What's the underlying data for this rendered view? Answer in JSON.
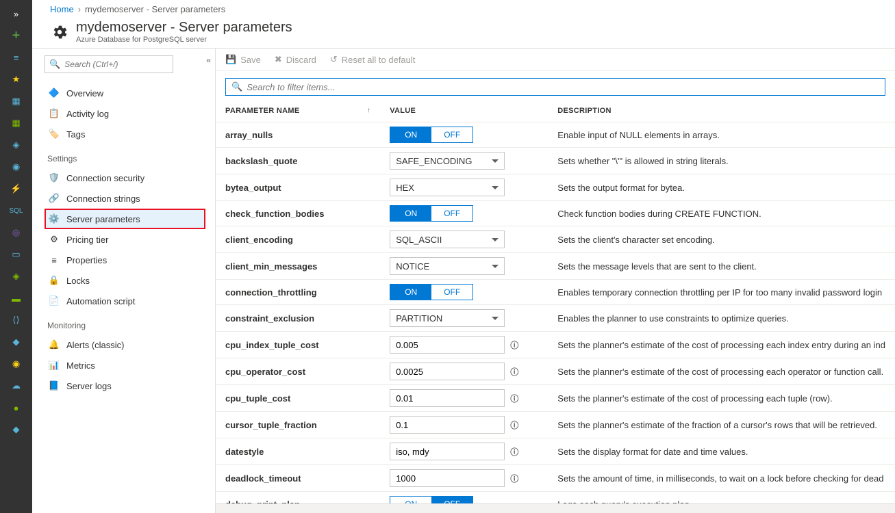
{
  "breadcrumb": {
    "home": "Home",
    "current": "mydemoserver - Server parameters"
  },
  "title": "mydemoserver - Server parameters",
  "subtitle": "Azure Database for PostgreSQL server",
  "sidebar": {
    "search_placeholder": "Search (Ctrl+/)",
    "top": [
      {
        "label": "Overview",
        "icon": "sphere"
      },
      {
        "label": "Activity log",
        "icon": "log"
      },
      {
        "label": "Tags",
        "icon": "tag"
      }
    ],
    "sections": [
      {
        "heading": "Settings",
        "items": [
          {
            "label": "Connection security",
            "icon": "shield"
          },
          {
            "label": "Connection strings",
            "icon": "link"
          },
          {
            "label": "Server parameters",
            "icon": "gear",
            "active": true
          },
          {
            "label": "Pricing tier",
            "icon": "pricing"
          },
          {
            "label": "Properties",
            "icon": "props"
          },
          {
            "label": "Locks",
            "icon": "lock"
          },
          {
            "label": "Automation script",
            "icon": "script"
          }
        ]
      },
      {
        "heading": "Monitoring",
        "items": [
          {
            "label": "Alerts (classic)",
            "icon": "alert"
          },
          {
            "label": "Metrics",
            "icon": "metrics"
          },
          {
            "label": "Server logs",
            "icon": "logs"
          }
        ]
      }
    ]
  },
  "toolbar": {
    "save": "Save",
    "discard": "Discard",
    "reset": "Reset all to default"
  },
  "filter_placeholder": "Search to filter items...",
  "columns": {
    "name": "Parameter Name",
    "value": "Value",
    "desc": "Description"
  },
  "rows": [
    {
      "name": "array_nulls",
      "type": "toggle",
      "value": "ON",
      "desc": "Enable input of NULL elements in arrays."
    },
    {
      "name": "backslash_quote",
      "type": "select",
      "value": "SAFE_ENCODING",
      "desc": "Sets whether \"\\'\" is allowed in string literals."
    },
    {
      "name": "bytea_output",
      "type": "select",
      "value": "HEX",
      "desc": "Sets the output format for bytea."
    },
    {
      "name": "check_function_bodies",
      "type": "toggle",
      "value": "ON",
      "desc": "Check function bodies during CREATE FUNCTION."
    },
    {
      "name": "client_encoding",
      "type": "select",
      "value": "SQL_ASCII",
      "desc": "Sets the client's character set encoding."
    },
    {
      "name": "client_min_messages",
      "type": "select",
      "value": "NOTICE",
      "desc": "Sets the message levels that are sent to the client."
    },
    {
      "name": "connection_throttling",
      "type": "toggle",
      "value": "ON",
      "desc": "Enables temporary connection throttling per IP for too many invalid password login"
    },
    {
      "name": "constraint_exclusion",
      "type": "select",
      "value": "PARTITION",
      "desc": "Enables the planner to use constraints to optimize queries."
    },
    {
      "name": "cpu_index_tuple_cost",
      "type": "text",
      "value": "0.005",
      "info": true,
      "desc": "Sets the planner's estimate of the cost of processing each index entry during an ind"
    },
    {
      "name": "cpu_operator_cost",
      "type": "text",
      "value": "0.0025",
      "info": true,
      "desc": "Sets the planner's estimate of the cost of processing each operator or function call."
    },
    {
      "name": "cpu_tuple_cost",
      "type": "text",
      "value": "0.01",
      "info": true,
      "desc": "Sets the planner's estimate of the cost of processing each tuple (row)."
    },
    {
      "name": "cursor_tuple_fraction",
      "type": "text",
      "value": "0.1",
      "info": true,
      "desc": "Sets the planner's estimate of the fraction of a cursor's rows that will be retrieved."
    },
    {
      "name": "datestyle",
      "type": "text",
      "value": "iso, mdy",
      "info": true,
      "desc": "Sets the display format for date and time values."
    },
    {
      "name": "deadlock_timeout",
      "type": "text",
      "value": "1000",
      "info": true,
      "desc": "Sets the amount of time, in milliseconds, to wait on a lock before checking for dead"
    },
    {
      "name": "debug_print_plan",
      "type": "toggle",
      "value": "OFF",
      "desc": "Logs each query's execution plan."
    }
  ],
  "toggle_labels": {
    "on": "ON",
    "off": "OFF"
  }
}
